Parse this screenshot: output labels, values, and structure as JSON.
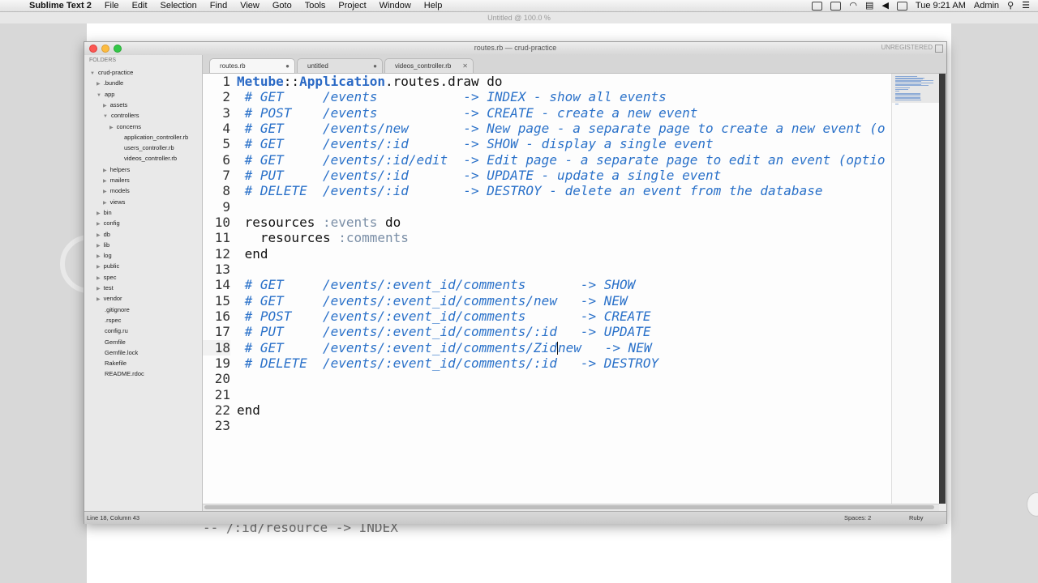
{
  "menubar": {
    "app_name": "Sublime Text 2",
    "menus": [
      "File",
      "Edit",
      "Selection",
      "Find",
      "View",
      "Goto",
      "Tools",
      "Project",
      "Window",
      "Help"
    ],
    "clock": "Tue 9:21 AM",
    "user": "Admin"
  },
  "background_window_title": "Untitled @ 100.0 %",
  "background_text": "-- /:id/resource -> INDEX",
  "window": {
    "title": "routes.rb — crud-practice",
    "registration": "UNREGISTERED"
  },
  "sidebar": {
    "header": "FOLDERS",
    "items": [
      {
        "label": "crud-practice",
        "arrow": "▼"
      },
      {
        "label": ".bundle",
        "arrow": "▶"
      },
      {
        "label": "app",
        "arrow": "▼"
      },
      {
        "label": "assets",
        "arrow": "▶"
      },
      {
        "label": "controllers",
        "arrow": "▼"
      },
      {
        "label": "concerns",
        "arrow": "▶"
      },
      {
        "label": "application_controller.rb",
        "arrow": ""
      },
      {
        "label": "users_controller.rb",
        "arrow": ""
      },
      {
        "label": "videos_controller.rb",
        "arrow": ""
      },
      {
        "label": "helpers",
        "arrow": "▶"
      },
      {
        "label": "mailers",
        "arrow": "▶"
      },
      {
        "label": "models",
        "arrow": "▶"
      },
      {
        "label": "views",
        "arrow": "▶"
      },
      {
        "label": "bin",
        "arrow": "▶"
      },
      {
        "label": "config",
        "arrow": "▶"
      },
      {
        "label": "db",
        "arrow": "▶"
      },
      {
        "label": "lib",
        "arrow": "▶"
      },
      {
        "label": "log",
        "arrow": "▶"
      },
      {
        "label": "public",
        "arrow": "▶"
      },
      {
        "label": "spec",
        "arrow": "▶"
      },
      {
        "label": "test",
        "arrow": "▶"
      },
      {
        "label": "vendor",
        "arrow": "▶"
      },
      {
        "label": ".gitignore",
        "arrow": ""
      },
      {
        "label": ".rspec",
        "arrow": ""
      },
      {
        "label": "config.ru",
        "arrow": ""
      },
      {
        "label": "Gemfile",
        "arrow": ""
      },
      {
        "label": "Gemfile.lock",
        "arrow": ""
      },
      {
        "label": "Rakefile",
        "arrow": ""
      },
      {
        "label": "README.rdoc",
        "arrow": ""
      }
    ]
  },
  "tabs": [
    {
      "label": "routes.rb",
      "close": "●"
    },
    {
      "label": "untitled",
      "close": "●"
    },
    {
      "label": "videos_controller.rb",
      "close": "✕"
    }
  ],
  "editor": {
    "line_numbers": [
      "1",
      "2",
      "3",
      "4",
      "5",
      "6",
      "7",
      "8",
      "9",
      "10",
      "11",
      "12",
      "13",
      "14",
      "15",
      "16",
      "17",
      "18",
      "19",
      "20",
      "21",
      "22",
      "23"
    ],
    "current_line": "18",
    "lines": [
      [
        {
          "t": "cls",
          "v": "Metube"
        },
        {
          "t": "kw",
          "v": "::"
        },
        {
          "t": "cls",
          "v": "Application"
        },
        {
          "t": "kw",
          "v": ".routes.draw do"
        }
      ],
      [
        {
          "t": "cm",
          "v": " # GET     /events           -> INDEX - show all events"
        }
      ],
      [
        {
          "t": "cm",
          "v": " # POST    /events           -> CREATE - create a new event"
        }
      ],
      [
        {
          "t": "cm",
          "v": " # GET     /events/new       -> New page - a separate page to create a new event (o"
        }
      ],
      [
        {
          "t": "cm",
          "v": " # GET     /events/:id       -> SHOW - display a single event"
        }
      ],
      [
        {
          "t": "cm",
          "v": " # GET     /events/:id/edit  -> Edit page - a separate page to edit an event (optio"
        }
      ],
      [
        {
          "t": "cm",
          "v": " # PUT     /events/:id       -> UPDATE - update a single event"
        }
      ],
      [
        {
          "t": "cm",
          "v": " # DELETE  /events/:id       -> DESTROY - delete an event from the database"
        }
      ],
      [],
      [
        {
          "t": "kw",
          "v": " resources "
        },
        {
          "t": "sym",
          "v": ":events"
        },
        {
          "t": "kw",
          "v": " do"
        }
      ],
      [
        {
          "t": "kw",
          "v": "   resources "
        },
        {
          "t": "sym",
          "v": ":comments"
        }
      ],
      [
        {
          "t": "kw",
          "v": " end"
        }
      ],
      [],
      [
        {
          "t": "cm",
          "v": " # GET     /events/:event_id/comments       -> SHOW"
        }
      ],
      [
        {
          "t": "cm",
          "v": " # GET     /events/:event_id/comments/new   -> NEW"
        }
      ],
      [
        {
          "t": "cm",
          "v": " # POST    /events/:event_id/comments       -> CREATE"
        }
      ],
      [
        {
          "t": "cm",
          "v": " # PUT     /events/:event_id/comments/:id   -> UPDATE"
        }
      ],
      [
        {
          "t": "cm",
          "v": " # GET     /events/:event_id/comments/Zid"
        },
        {
          "t": "cursor",
          "v": ""
        },
        {
          "t": "cm",
          "v": "new   -> NEW"
        }
      ],
      [
        {
          "t": "cm",
          "v": " # DELETE  /events/:event_id/comments/:id   -> DESTROY"
        }
      ],
      [],
      [],
      [
        {
          "t": "kw",
          "v": "end"
        }
      ],
      []
    ]
  },
  "statusbar": {
    "position": "Line 18, Column 43",
    "spaces": "Spaces: 2",
    "syntax": "Ruby"
  }
}
